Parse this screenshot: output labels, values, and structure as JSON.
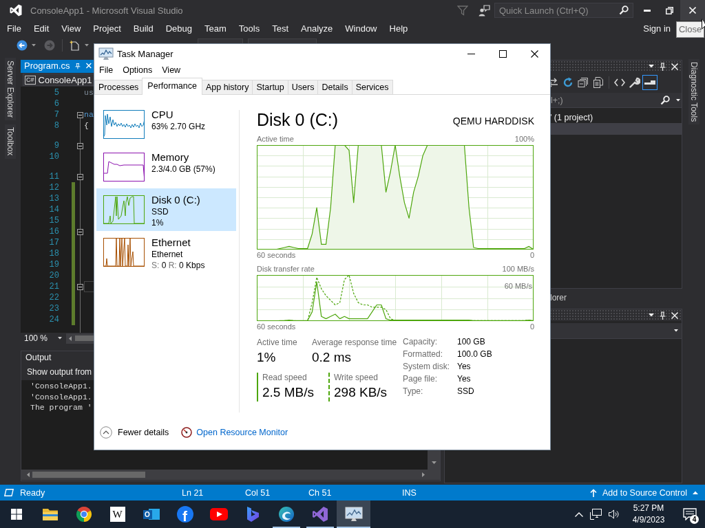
{
  "vs": {
    "title": "ConsoleApp1 - Microsoft Visual Studio",
    "quick_launch": {
      "placeholder": "Quick Launch (Ctrl+Q)"
    },
    "close_hovered": true,
    "tooltip": "Close",
    "menu": [
      "File",
      "Edit",
      "View",
      "Project",
      "Build",
      "Debug",
      "Team",
      "Tools",
      "Test",
      "Analyze",
      "Window",
      "Help"
    ],
    "sign_in": "Sign in",
    "left_tabs": [
      "Server Explorer",
      "Toolbox"
    ],
    "right_tabs": [
      "Diagnostic Tools"
    ],
    "editor": {
      "tab": {
        "label": "Program.cs",
        "selected": true
      },
      "language": "C#",
      "project": "ConsoleApp1",
      "zoom": "100 %",
      "line_groups": [
        {
          "lines": [
            {
              "number": "5",
              "code": {
                "text": "us",
                "kind": "faded"
              },
              "fold": false,
              "changed": false,
              "current": false
            },
            {
              "number": "6",
              "fold": false,
              "changed": false,
              "current": false
            },
            {
              "number": "7",
              "code": {
                "text": "na",
                "kind": "keyword"
              },
              "fold": true,
              "changed": false,
              "current": false
            },
            {
              "number": "8",
              "code": {
                "text": "{",
                "kind": "plain"
              },
              "fold": false,
              "changed": false,
              "current": false
            }
          ]
        },
        {
          "lines": [
            {
              "number": "9",
              "fold": true,
              "changed": false,
              "current": false
            },
            {
              "number": "10",
              "fold": false,
              "changed": false,
              "current": false
            }
          ]
        },
        {
          "lines": [
            {
              "number": "11",
              "fold": true,
              "changed": false,
              "current": false
            },
            {
              "number": "12",
              "fold": false,
              "changed": true,
              "current": false
            },
            {
              "number": "13",
              "fold": false,
              "changed": true,
              "current": false
            },
            {
              "number": "14",
              "fold": false,
              "changed": true,
              "current": false
            },
            {
              "number": "15",
              "fold": false,
              "changed": true,
              "current": false
            },
            {
              "number": "16",
              "fold": true,
              "changed": true,
              "current": false
            },
            {
              "number": "17",
              "fold": false,
              "changed": true,
              "current": false
            },
            {
              "number": "18",
              "fold": false,
              "changed": true,
              "current": false
            },
            {
              "number": "19",
              "fold": false,
              "changed": true,
              "current": false
            },
            {
              "number": "20",
              "fold": false,
              "changed": true,
              "current": false
            },
            {
              "number": "21",
              "fold": true,
              "changed": true,
              "current": true
            },
            {
              "number": "22",
              "fold": false,
              "changed": true,
              "current": false
            },
            {
              "number": "23",
              "fold": false,
              "changed": true,
              "current": false
            },
            {
              "number": "24",
              "fold": false,
              "changed": true,
              "current": false
            }
          ]
        }
      ]
    },
    "output": {
      "title": "Output",
      "source_label": "Show output from",
      "lines": [
        "'ConsoleApp1.",
        "'ConsoleApp1.",
        "The program '"
      ]
    },
    "solution_explorer": {
      "toolbar": [
        {
          "kind": "sync",
          "selected": false
        },
        {
          "kind": "refresh",
          "selected": false
        },
        {
          "kind": "collapse",
          "selected": false
        },
        {
          "kind": "pages",
          "selected": false
        },
        {
          "kind": "code",
          "selected": false
        },
        {
          "kind": "wrench",
          "selected": false
        },
        {
          "kind": "preview",
          "selected": true
        }
      ],
      "search": {
        "placeholder": "l+;)"
      },
      "rows": [
        {
          "label": "' (1 project)",
          "selected": false
        },
        {
          "selected": true
        }
      ],
      "tab": "lorer"
    },
    "status_bar": {
      "state": "Ready",
      "line": "Ln 21",
      "column": "Col 51",
      "char": "Ch 51",
      "mode": "INS",
      "source_control": "Add to Source Control"
    }
  },
  "task_manager": {
    "title": "Task Manager",
    "menu": [
      "File",
      "Options",
      "View"
    ],
    "tabs": [
      {
        "label": "Processes",
        "selected": false
      },
      {
        "label": "Performance",
        "selected": true
      },
      {
        "label": "App history",
        "selected": false
      },
      {
        "label": "Startup",
        "selected": false
      },
      {
        "label": "Users",
        "selected": false
      },
      {
        "label": "Details",
        "selected": false
      },
      {
        "label": "Services",
        "selected": false
      }
    ],
    "resources": [
      {
        "kind": "cpu",
        "name": "CPU",
        "details": [
          "63% 2.70 GHz"
        ],
        "color": "#117dbb",
        "selected": false
      },
      {
        "kind": "memory",
        "name": "Memory",
        "details": [
          "2.3/4.0 GB (57%)"
        ],
        "color": "#8b12ae",
        "selected": false
      },
      {
        "kind": "disk",
        "name": "Disk 0 (C:)",
        "details": [
          "SSD",
          "1%"
        ],
        "color": "#4da60c",
        "selected": true
      },
      {
        "kind": "network",
        "name": "Ethernet",
        "details": [
          "Ethernet"
        ],
        "rates": [
          {
            "label": "S:",
            "value": "0"
          },
          {
            "label": "R:",
            "value": "0 Kbps"
          }
        ],
        "color": "#a74f01",
        "selected": false
      }
    ],
    "detail": {
      "title": "Disk 0 (C:)",
      "model": "QEMU HARDDISK",
      "active_time_graph": {
        "title": "Active time",
        "max_label": "100%",
        "span_label": "60 seconds",
        "min_label": "0"
      },
      "transfer_graph": {
        "title": "Disk transfer rate",
        "max_label": "100 MB/s",
        "marker_label": "60 MB/s",
        "span_label": "60 seconds",
        "min_label": "0"
      },
      "metrics": [
        {
          "label": "Active time",
          "value": "1%"
        },
        {
          "label": "Average response time",
          "value": "0.2 ms"
        }
      ],
      "speeds": [
        {
          "label": "Read speed",
          "value": "2.5 MB/s",
          "dashed": false
        },
        {
          "label": "Write speed",
          "value": "298 KB/s",
          "dashed": true
        }
      ],
      "properties": [
        {
          "label": "Capacity:",
          "value": "100 GB"
        },
        {
          "label": "Formatted:",
          "value": "100.0 GB"
        },
        {
          "label": "System disk:",
          "value": "Yes"
        },
        {
          "label": "Page file:",
          "value": "Yes"
        },
        {
          "label": "Type:",
          "value": "SSD"
        }
      ]
    },
    "footer": {
      "fewer_details": "Fewer details",
      "resource_monitor": "Open Resource Monitor"
    }
  },
  "taskbar": {
    "apps": [
      {
        "kind": "start",
        "running": false,
        "focused": false
      },
      {
        "kind": "folder",
        "running": false,
        "focused": false
      },
      {
        "kind": "ring",
        "running": false,
        "focused": false
      },
      {
        "kind": "letter_tile",
        "glyph": "W",
        "running": false,
        "focused": false
      },
      {
        "kind": "mail",
        "glyph": "O",
        "running": false,
        "focused": false
      },
      {
        "kind": "letter_circle",
        "glyph": "f",
        "running": false,
        "focused": false
      },
      {
        "kind": "play",
        "running": false,
        "focused": false
      },
      {
        "kind": "swirl",
        "running": false,
        "focused": false
      },
      {
        "kind": "wave",
        "running": true,
        "focused": false
      },
      {
        "kind": "bowtie",
        "running": true,
        "focused": false
      },
      {
        "kind": "monitor",
        "running": true,
        "focused": true
      }
    ],
    "time": "5:27 PM",
    "date": "4/9/2023",
    "notifications": "4"
  }
}
